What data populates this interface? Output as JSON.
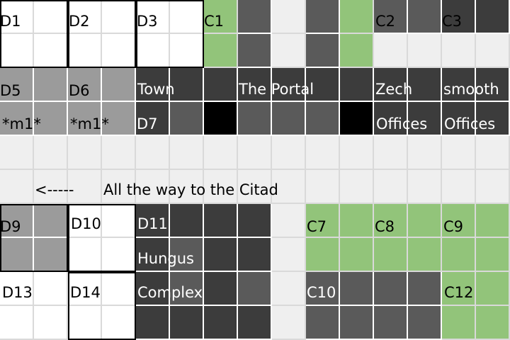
{
  "colors": {
    "white": "#ffffff",
    "light_gray": "#efefef",
    "mid_gray": "#9b9b9b",
    "dark_gray": "#5a5a5a",
    "charcoal": "#3c3c3c",
    "green": "#92c47a",
    "black": "#000000",
    "grid_line": "#d9d9d9"
  },
  "labels": {
    "d1": "D1",
    "d2": "D2",
    "d3": "D3",
    "c1": "C1",
    "c2": "C2",
    "c3": "C3",
    "d5": "D5",
    "d6": "D6",
    "m1_a": "*m1*",
    "m1_b": "*m1*",
    "town": "Town",
    "d7": "D7",
    "the_portal": "The Portal",
    "zech": "Zech",
    "offices_1": "Offices",
    "smooth": "smooth",
    "offices_2": "Offices",
    "arrow": "<-----",
    "citadel_path": "All the way to the Citad",
    "d9": "D9",
    "d10": "D10",
    "d11": "D11",
    "hungus": "Hungus",
    "complex": "Complex",
    "c7": "C7",
    "c8": "C8",
    "c9": "C9",
    "d13": "D13",
    "d14": "D14",
    "c10": "C10",
    "c12": "C12"
  }
}
